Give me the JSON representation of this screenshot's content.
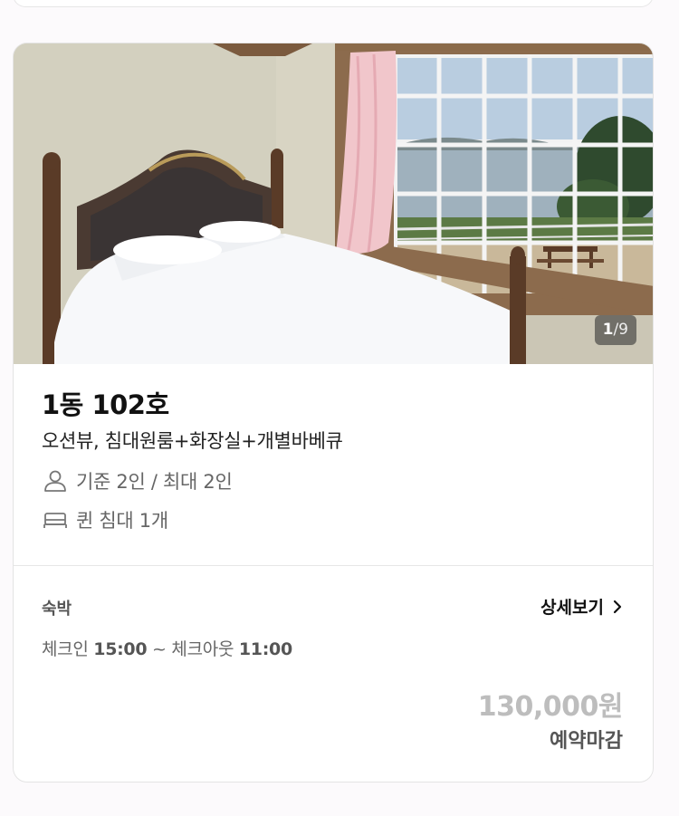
{
  "room": {
    "name": "1동 102호",
    "description": "오션뷰, 침대원룸+화장실+개별바베큐",
    "capacity": "기준 2인 / 최대 2인",
    "bed": "퀸 침대 1개",
    "photo_counter": {
      "current": "1",
      "separator": "/",
      "total": "9"
    }
  },
  "booking": {
    "stay_type": "숙박",
    "detail_link": "상세보기",
    "checkin_label": "체크인",
    "checkin_time": "15:00",
    "tilde": "~",
    "checkout_label": "체크아웃",
    "checkout_time": "11:00",
    "price": "130,000원",
    "status": "예약마감"
  },
  "icons": {
    "capacity": "person-icon",
    "bed": "bed-icon",
    "detail": "chevron-right-icon"
  },
  "colors": {
    "price_disabled": "#bdbdbd",
    "text_secondary": "#666666",
    "border": "#e4e4e4"
  }
}
